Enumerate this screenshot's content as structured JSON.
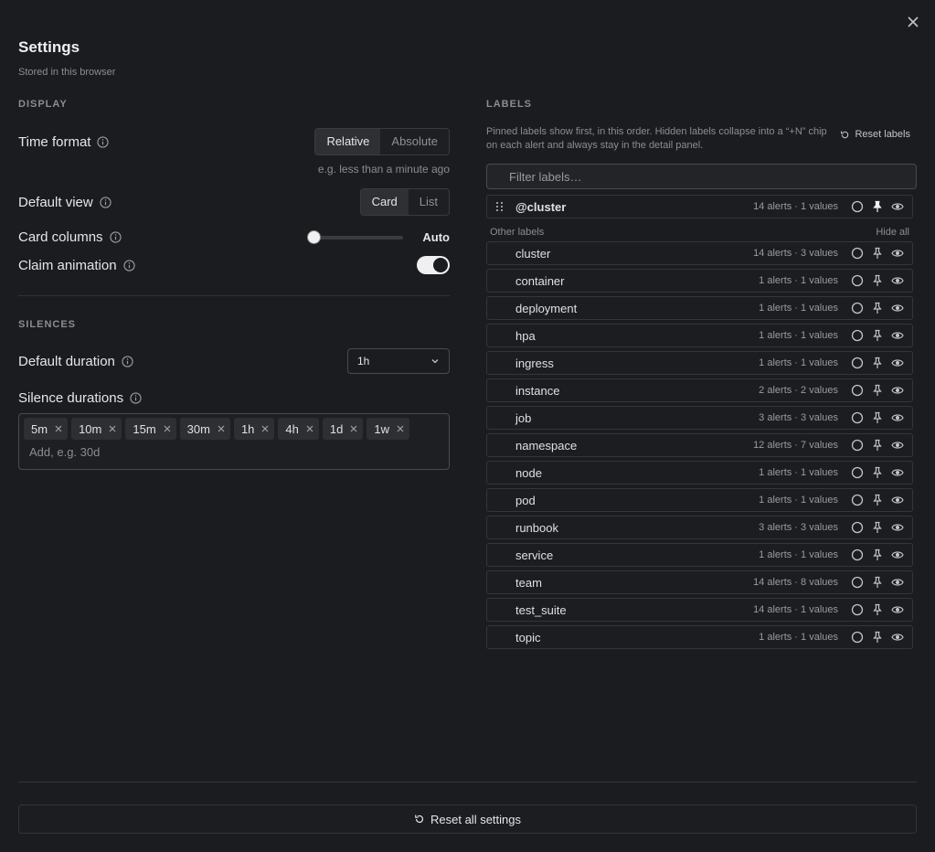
{
  "header": {
    "title": "Settings",
    "subtitle": "Stored in this browser"
  },
  "display": {
    "section_title": "DISPLAY",
    "time_format": {
      "label": "Time format",
      "options": [
        "Relative",
        "Absolute"
      ],
      "selected": "Relative",
      "hint": "e.g. less than a minute ago"
    },
    "default_view": {
      "label": "Default view",
      "options": [
        "Card",
        "List"
      ],
      "selected": "Card"
    },
    "card_columns": {
      "label": "Card columns",
      "value_label": "Auto",
      "slider_fraction": 0
    },
    "claim_animation": {
      "label": "Claim animation",
      "enabled": true
    }
  },
  "silences": {
    "section_title": "SILENCES",
    "default_duration": {
      "label": "Default duration",
      "value": "1h"
    },
    "silence_durations": {
      "label": "Silence durations",
      "chips": [
        "5m",
        "10m",
        "15m",
        "30m",
        "1h",
        "4h",
        "1d",
        "1w"
      ],
      "placeholder": "Add, e.g. 30d"
    }
  },
  "labels": {
    "section_title": "LABELS",
    "description": "Pinned labels show first, in this order. Hidden labels collapse into a “+N” chip on each alert and always stay in the detail panel.",
    "reset_label": "Reset labels",
    "filter_placeholder": "Filter labels…",
    "pinned": [
      {
        "name": "@cluster",
        "meta": "14 alerts · 1 values"
      }
    ],
    "other_header": "Other labels",
    "hide_all": "Hide all",
    "others": [
      {
        "name": "cluster",
        "meta": "14 alerts · 3 values"
      },
      {
        "name": "container",
        "meta": "1 alerts · 1 values"
      },
      {
        "name": "deployment",
        "meta": "1 alerts · 1 values"
      },
      {
        "name": "hpa",
        "meta": "1 alerts · 1 values"
      },
      {
        "name": "ingress",
        "meta": "1 alerts · 1 values"
      },
      {
        "name": "instance",
        "meta": "2 alerts · 2 values"
      },
      {
        "name": "job",
        "meta": "3 alerts · 3 values"
      },
      {
        "name": "namespace",
        "meta": "12 alerts · 7 values"
      },
      {
        "name": "node",
        "meta": "1 alerts · 1 values"
      },
      {
        "name": "pod",
        "meta": "1 alerts · 1 values"
      },
      {
        "name": "runbook",
        "meta": "3 alerts · 3 values"
      },
      {
        "name": "service",
        "meta": "1 alerts · 1 values"
      },
      {
        "name": "team",
        "meta": "14 alerts · 8 values"
      },
      {
        "name": "test_suite",
        "meta": "14 alerts · 1 values"
      },
      {
        "name": "topic",
        "meta": "1 alerts · 1 values"
      }
    ]
  },
  "footer": {
    "reset_all": "Reset all settings"
  },
  "icons": [
    "close-icon",
    "info-icon",
    "chevron-down-icon",
    "x-icon",
    "reset-icon",
    "drag-handle-icon",
    "circle-icon",
    "pin-icon",
    "eye-icon"
  ]
}
